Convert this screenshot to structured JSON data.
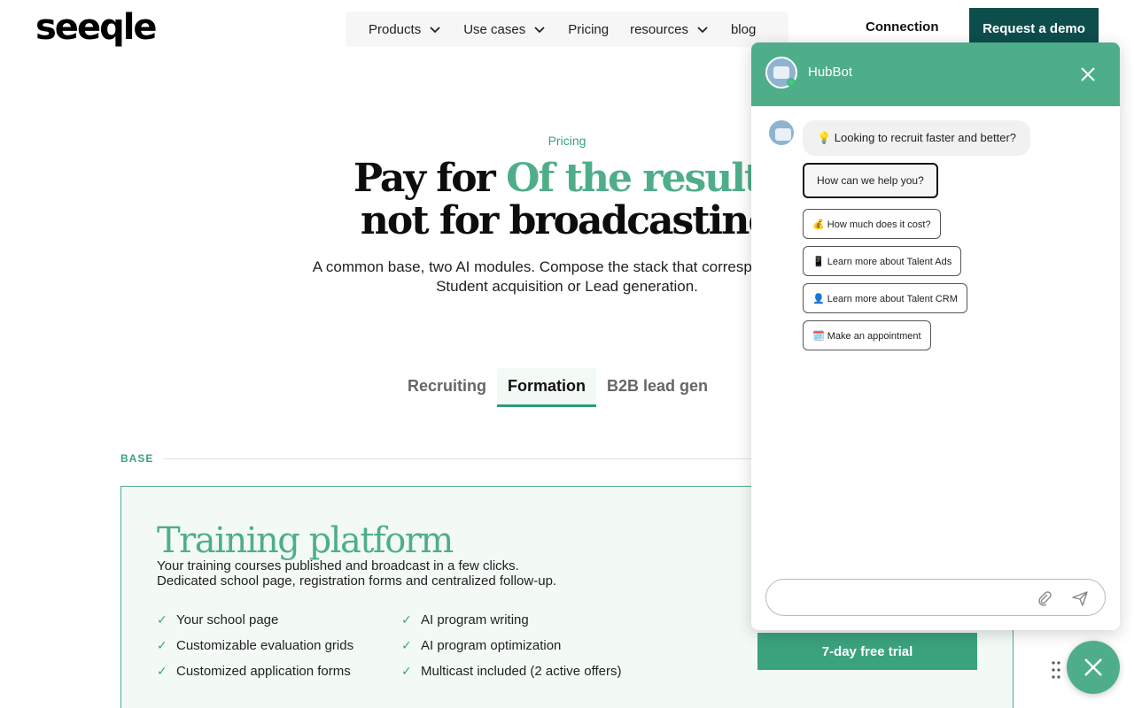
{
  "header": {
    "logo": "seeqle",
    "nav": [
      {
        "label": "Products",
        "dropdown": true
      },
      {
        "label": "Use cases",
        "dropdown": true
      },
      {
        "label": "Pricing",
        "dropdown": false
      },
      {
        "label": "resources",
        "dropdown": true
      },
      {
        "label": "blog",
        "dropdown": false
      }
    ],
    "connection": "Connection",
    "demo": "Request a demo"
  },
  "hero": {
    "eyebrow": "Pricing",
    "title_part1": "Pay for ",
    "title_accent": "Of the results",
    "title_line2": "not for broadcasting",
    "subtitle_line1": "A common base, two AI modules. Compose the stack that corresponds to yo",
    "subtitle_line2": "Student acquisition or Lead generation."
  },
  "tabs": [
    {
      "label": "Recruiting",
      "active": false
    },
    {
      "label": "Formation",
      "active": true
    },
    {
      "label": "B2B lead gen",
      "active": false
    }
  ],
  "base": {
    "label": "BASE",
    "card_title": "Training platform",
    "desc_line1": "Your training courses published and broadcast in a few clicks.",
    "desc_line2": "Dedicated school page, registration forms and centralized follow-up.",
    "features_left": [
      "Your school page",
      "Customizable evaluation grids",
      "Customized application forms"
    ],
    "features_right": [
      "AI program writing",
      "AI program optimization",
      "Multicast included (2 active offers)"
    ],
    "trial": "7-day free trial"
  },
  "chat": {
    "bot_name": "HubBot",
    "greeting": "💡 Looking to recruit faster and better?",
    "options": [
      "How can we help you?",
      "💰 How much does it cost?",
      "📱 Learn more about Talent Ads",
      "👤 Learn more about Talent CRM",
      "🗓️ Make an appointment"
    ],
    "input_placeholder": ""
  },
  "colors": {
    "brand_green": "#4fae8a",
    "dark_teal": "#0d4d4b",
    "accent_green": "#3aa27d"
  }
}
